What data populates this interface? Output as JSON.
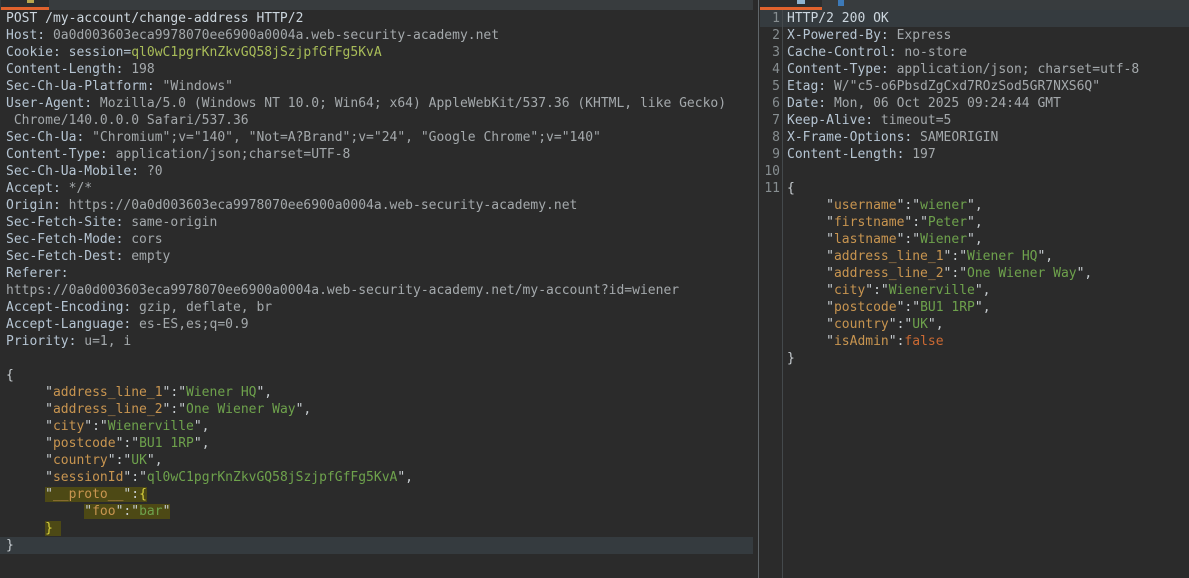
{
  "app": "http-message-editor",
  "colors": {
    "background": "#2b2b2b",
    "tab_accent_orange": "#e0622d",
    "current_line_highlight": "#353b3f",
    "search_match_highlight": "#4d4915",
    "json_key": "#c89550",
    "json_string": "#6ea24c",
    "header_name": "#b6c5d3",
    "header_value": "#a4a9ac"
  },
  "request": {
    "lines": [
      {
        "seg": [
          [
            "req",
            "POST /my-account/change-address HTTP/2"
          ]
        ]
      },
      {
        "seg": [
          [
            "hn",
            "Host:"
          ],
          [
            "hv",
            " 0a0d003603eca9978070ee6900a0004a.web-security-academy.net"
          ]
        ]
      },
      {
        "seg": [
          [
            "hn",
            "Cookie: session="
          ],
          [
            "ck",
            "ql0wC1pgrKnZkvGQ58jSzjpfGfFg5KvA"
          ]
        ]
      },
      {
        "seg": [
          [
            "hn",
            "Content-Length:"
          ],
          [
            "hv",
            " 198"
          ]
        ]
      },
      {
        "seg": [
          [
            "hn",
            "Sec-Ch-Ua-Platform:"
          ],
          [
            "hv",
            " \"Windows\""
          ]
        ]
      },
      {
        "seg": [
          [
            "hn",
            "User-Agent:"
          ],
          [
            "hv",
            " Mozilla/5.0 (Windows NT 10.0; Win64; x64) AppleWebKit/537.36 (KHTML, like Gecko)"
          ]
        ]
      },
      {
        "seg": [
          [
            "hv",
            " Chrome/140.0.0.0 Safari/537.36"
          ]
        ]
      },
      {
        "seg": [
          [
            "hn",
            "Sec-Ch-Ua:"
          ],
          [
            "hv",
            " \"Chromium\";v=\"140\", \"Not=A?Brand\";v=\"24\", \"Google Chrome\";v=\"140\""
          ]
        ]
      },
      {
        "seg": [
          [
            "hn",
            "Content-Type:"
          ],
          [
            "hv",
            " application/json;charset=UTF-8"
          ]
        ]
      },
      {
        "seg": [
          [
            "hn",
            "Sec-Ch-Ua-Mobile:"
          ],
          [
            "hv",
            " ?0"
          ]
        ]
      },
      {
        "seg": [
          [
            "hn",
            "Accept:"
          ],
          [
            "hv",
            " */*"
          ]
        ]
      },
      {
        "seg": [
          [
            "hn",
            "Origin:"
          ],
          [
            "hv",
            " https://0a0d003603eca9978070ee6900a0004a.web-security-academy.net"
          ]
        ]
      },
      {
        "seg": [
          [
            "hn",
            "Sec-Fetch-Site:"
          ],
          [
            "hv",
            " same-origin"
          ]
        ]
      },
      {
        "seg": [
          [
            "hn",
            "Sec-Fetch-Mode:"
          ],
          [
            "hv",
            " cors"
          ]
        ]
      },
      {
        "seg": [
          [
            "hn",
            "Sec-Fetch-Dest:"
          ],
          [
            "hv",
            " empty"
          ]
        ]
      },
      {
        "seg": [
          [
            "hn",
            "Referer:"
          ]
        ]
      },
      {
        "seg": [
          [
            "hv",
            "https://0a0d003603eca9978070ee6900a0004a.web-security-academy.net/my-account?id=wiener"
          ]
        ]
      },
      {
        "seg": [
          [
            "hn",
            "Accept-Encoding:"
          ],
          [
            "hv",
            " gzip, deflate, br"
          ]
        ]
      },
      {
        "seg": [
          [
            "hn",
            "Accept-Language:"
          ],
          [
            "hv",
            " es-ES,es;q=0.9"
          ]
        ]
      },
      {
        "seg": [
          [
            "hn",
            "Priority:"
          ],
          [
            "hv",
            " u=1, i"
          ]
        ]
      },
      {
        "seg": []
      },
      {
        "seg": [
          [
            "pun",
            "{"
          ]
        ]
      },
      {
        "pre": 5,
        "seg": [
          [
            "pun",
            "\""
          ],
          [
            "key",
            "address_line_1"
          ],
          [
            "pun",
            "\":\""
          ],
          [
            "str",
            "Wiener HQ"
          ],
          [
            "pun",
            "\","
          ]
        ]
      },
      {
        "pre": 5,
        "seg": [
          [
            "pun",
            "\""
          ],
          [
            "key",
            "address_line_2"
          ],
          [
            "pun",
            "\":\""
          ],
          [
            "str",
            "One Wiener Way"
          ],
          [
            "pun",
            "\","
          ]
        ]
      },
      {
        "pre": 5,
        "seg": [
          [
            "pun",
            "\""
          ],
          [
            "key",
            "city"
          ],
          [
            "pun",
            "\":\""
          ],
          [
            "str",
            "Wienerville"
          ],
          [
            "pun",
            "\","
          ]
        ]
      },
      {
        "pre": 5,
        "seg": [
          [
            "pun",
            "\""
          ],
          [
            "key",
            "postcode"
          ],
          [
            "pun",
            "\":\""
          ],
          [
            "str",
            "BU1 1RP"
          ],
          [
            "pun",
            "\","
          ]
        ]
      },
      {
        "pre": 5,
        "seg": [
          [
            "pun",
            "\""
          ],
          [
            "key",
            "country"
          ],
          [
            "pun",
            "\":\""
          ],
          [
            "str",
            "UK"
          ],
          [
            "pun",
            "\","
          ]
        ]
      },
      {
        "pre": 5,
        "seg": [
          [
            "pun",
            "\""
          ],
          [
            "key",
            "sessionId"
          ],
          [
            "pun",
            "\":\""
          ],
          [
            "str",
            "ql0wC1pgrKnZkvGQ58jSzjpfGfFg5KvA"
          ],
          [
            "pun",
            "\","
          ]
        ]
      },
      {
        "pre": 5,
        "hl": true,
        "seg": [
          [
            "pun",
            "\""
          ],
          [
            "key",
            "__proto__"
          ],
          [
            "pun",
            "\":"
          ],
          [
            "brc",
            "{"
          ]
        ]
      },
      {
        "pre": 10,
        "hl": true,
        "seg": [
          [
            "pun",
            "\""
          ],
          [
            "key",
            "foo"
          ],
          [
            "pun",
            "\":\""
          ],
          [
            "str",
            "bar"
          ],
          [
            "pun",
            "\""
          ]
        ]
      },
      {
        "pre": 5,
        "hl": true,
        "seg": [
          [
            "brc",
            "} "
          ]
        ]
      },
      {
        "cls": "cur",
        "seg": [
          [
            "pun",
            "}"
          ]
        ]
      }
    ]
  },
  "response": {
    "lines": [
      {
        "n": "1",
        "cls": "cur",
        "seg": [
          [
            "req",
            "HTTP/2 200 OK"
          ]
        ]
      },
      {
        "n": "2",
        "seg": [
          [
            "hn",
            "X-Powered-By:"
          ],
          [
            "hv",
            " Express"
          ]
        ]
      },
      {
        "n": "3",
        "seg": [
          [
            "hn",
            "Cache-Control:"
          ],
          [
            "hv",
            " no-store"
          ]
        ]
      },
      {
        "n": "4",
        "seg": [
          [
            "hn",
            "Content-Type:"
          ],
          [
            "hv",
            " application/json; charset=utf-8"
          ]
        ]
      },
      {
        "n": "5",
        "seg": [
          [
            "hn",
            "Etag:"
          ],
          [
            "hv",
            " W/\"c5-o6PbsdZgCxd7ROzSod5GR7NXS6Q\""
          ]
        ]
      },
      {
        "n": "6",
        "seg": [
          [
            "hn",
            "Date:"
          ],
          [
            "hv",
            " Mon, 06 Oct 2025 09:24:44 GMT"
          ]
        ]
      },
      {
        "n": "7",
        "seg": [
          [
            "hn",
            "Keep-Alive:"
          ],
          [
            "hv",
            " timeout=5"
          ]
        ]
      },
      {
        "n": "8",
        "seg": [
          [
            "hn",
            "X-Frame-Options:"
          ],
          [
            "hv",
            " SAMEORIGIN"
          ]
        ]
      },
      {
        "n": "9",
        "seg": [
          [
            "hn",
            "Content-Length:"
          ],
          [
            "hv",
            " 197"
          ]
        ]
      },
      {
        "n": "10",
        "seg": []
      },
      {
        "n": "11",
        "seg": [
          [
            "pun",
            "{"
          ]
        ]
      },
      {
        "pre": 5,
        "seg": [
          [
            "pun",
            "\""
          ],
          [
            "key",
            "username"
          ],
          [
            "pun",
            "\":\""
          ],
          [
            "str",
            "wiener"
          ],
          [
            "pun",
            "\","
          ]
        ]
      },
      {
        "pre": 5,
        "seg": [
          [
            "pun",
            "\""
          ],
          [
            "key",
            "firstname"
          ],
          [
            "pun",
            "\":\""
          ],
          [
            "str",
            "Peter"
          ],
          [
            "pun",
            "\","
          ]
        ]
      },
      {
        "pre": 5,
        "seg": [
          [
            "pun",
            "\""
          ],
          [
            "key",
            "lastname"
          ],
          [
            "pun",
            "\":\""
          ],
          [
            "str",
            "Wiener"
          ],
          [
            "pun",
            "\","
          ]
        ]
      },
      {
        "pre": 5,
        "seg": [
          [
            "pun",
            "\""
          ],
          [
            "key",
            "address_line_1"
          ],
          [
            "pun",
            "\":\""
          ],
          [
            "str",
            "Wiener HQ"
          ],
          [
            "pun",
            "\","
          ]
        ]
      },
      {
        "pre": 5,
        "seg": [
          [
            "pun",
            "\""
          ],
          [
            "key",
            "address_line_2"
          ],
          [
            "pun",
            "\":\""
          ],
          [
            "str",
            "One Wiener Way"
          ],
          [
            "pun",
            "\","
          ]
        ]
      },
      {
        "pre": 5,
        "seg": [
          [
            "pun",
            "\""
          ],
          [
            "key",
            "city"
          ],
          [
            "pun",
            "\":\""
          ],
          [
            "str",
            "Wienerville"
          ],
          [
            "pun",
            "\","
          ]
        ]
      },
      {
        "pre": 5,
        "seg": [
          [
            "pun",
            "\""
          ],
          [
            "key",
            "postcode"
          ],
          [
            "pun",
            "\":\""
          ],
          [
            "str",
            "BU1 1RP"
          ],
          [
            "pun",
            "\","
          ]
        ]
      },
      {
        "pre": 5,
        "seg": [
          [
            "pun",
            "\""
          ],
          [
            "key",
            "country"
          ],
          [
            "pun",
            "\":\""
          ],
          [
            "str",
            "UK"
          ],
          [
            "pun",
            "\","
          ]
        ]
      },
      {
        "pre": 5,
        "seg": [
          [
            "pun",
            "\""
          ],
          [
            "key",
            "isAdmin"
          ],
          [
            "pun",
            "\":"
          ],
          [
            "bool",
            "false"
          ]
        ]
      },
      {
        "seg": [
          [
            "pun",
            "}"
          ]
        ]
      }
    ]
  }
}
